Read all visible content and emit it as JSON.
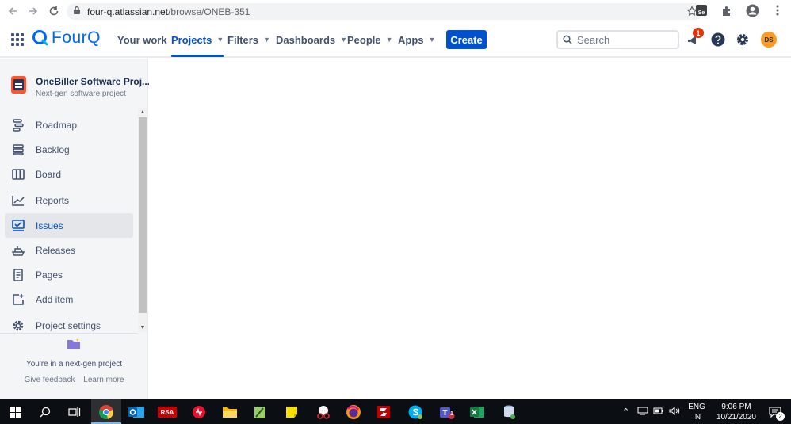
{
  "browser": {
    "url_host": "four-q.atlassian.net",
    "url_path": "/browse/ONEB-351",
    "extension_label": "Se"
  },
  "header": {
    "logo_text": "FourQ",
    "nav": [
      {
        "label": "Your work",
        "has_dropdown": false,
        "active": false
      },
      {
        "label": "Projects",
        "has_dropdown": true,
        "active": true
      },
      {
        "label": "Filters",
        "has_dropdown": true,
        "active": false
      },
      {
        "label": "Dashboards",
        "has_dropdown": true,
        "active": false
      },
      {
        "label": "People",
        "has_dropdown": true,
        "active": false
      },
      {
        "label": "Apps",
        "has_dropdown": true,
        "active": false
      }
    ],
    "create_label": "Create",
    "search_placeholder": "Search",
    "notification_count": "1",
    "avatar_initials": "DS"
  },
  "sidebar": {
    "project_name": "OneBiller Software Proj...",
    "project_type": "Next-gen software project",
    "items": [
      {
        "label": "Roadmap",
        "icon": "roadmap-icon",
        "active": false
      },
      {
        "label": "Backlog",
        "icon": "backlog-icon",
        "active": false
      },
      {
        "label": "Board",
        "icon": "board-icon",
        "active": false
      },
      {
        "label": "Reports",
        "icon": "reports-icon",
        "active": false
      },
      {
        "label": "Issues",
        "icon": "issues-icon",
        "active": true
      },
      {
        "label": "Releases",
        "icon": "releases-icon",
        "active": false
      },
      {
        "label": "Pages",
        "icon": "pages-icon",
        "active": false
      },
      {
        "label": "Add item",
        "icon": "add-item-icon",
        "active": false
      },
      {
        "label": "Project settings",
        "icon": "settings-icon",
        "active": false
      }
    ],
    "footer_message": "You're in a next-gen project",
    "give_feedback": "Give feedback",
    "learn_more": "Learn more"
  },
  "taskbar": {
    "language_top": "ENG",
    "language_bottom": "IN",
    "time": "9:06 PM",
    "date": "10/21/2020",
    "notification_count": "2",
    "rsa_label": "RSA",
    "teams_badge": "1"
  },
  "colors": {
    "jira_blue": "#0052CC",
    "sidebar_bg": "#F4F5F7",
    "text_primary": "#172B4D",
    "text_secondary": "#42526E"
  }
}
